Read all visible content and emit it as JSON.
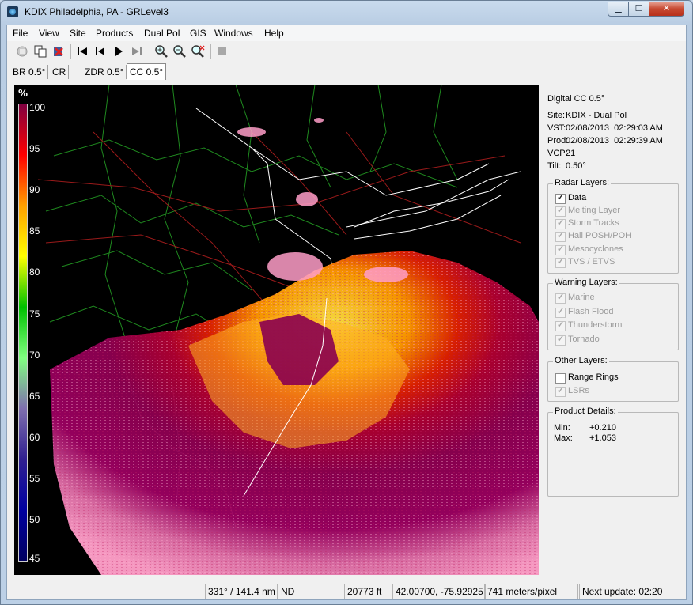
{
  "window": {
    "title": "KDIX Philadelphia, PA - GRLevel3",
    "minimize_glyph": "▁",
    "maximize_glyph": "☐",
    "close_glyph": "✕",
    "app_icon": "radar-app-icon"
  },
  "menu": [
    "File",
    "View",
    "Site",
    "Products",
    "Dual Pol",
    "GIS",
    "Windows",
    "Help"
  ],
  "toolbar": {
    "icons": [
      "refresh-disabled-icon",
      "copy-icon",
      "delete-icon",
      "first-frame-icon",
      "previous-frame-icon",
      "play-icon",
      "last-frame-icon",
      "zoom-in-icon",
      "zoom-out-icon",
      "zoom-reset-icon",
      "stop-icon"
    ]
  },
  "tabs": [
    "BR 0.5°",
    "CR",
    "ZDR 0.5°",
    "CC 0.5°"
  ],
  "active_tab": "CC 0.5°",
  "legend": {
    "unit": "%",
    "ticks": [
      "100",
      "95",
      "90",
      "85",
      "80",
      "75",
      "70",
      "65",
      "60",
      "55",
      "50",
      "45"
    ],
    "colors": [
      "#800040",
      "#ff0000",
      "#ffa000",
      "#ffff00",
      "#00c000",
      "#80ff80",
      "#7f6faf",
      "#302090",
      "#0000a0",
      "#000060"
    ]
  },
  "info": {
    "product": "Digital CC 0.5°",
    "site_label": "Site:",
    "site_value": "KDIX - Dual Pol",
    "vst_label": "VST:",
    "vst_value": "02/08/2013  02:29:03 AM",
    "prod_label": "Prod:",
    "prod_value": "02/08/2013  02:29:39 AM",
    "vcp_label": "VCP:",
    "vcp_value": "21",
    "tilt_label": "Tilt:",
    "tilt_value": "0.50°"
  },
  "radar_layers": {
    "title": "Radar Layers:",
    "items": [
      {
        "label": "Data",
        "checked": true,
        "enabled": true
      },
      {
        "label": "Melting Layer",
        "checked": true,
        "enabled": false
      },
      {
        "label": "Storm Tracks",
        "checked": true,
        "enabled": false
      },
      {
        "label": "Hail POSH/POH",
        "checked": true,
        "enabled": false
      },
      {
        "label": "Mesocyclones",
        "checked": true,
        "enabled": false
      },
      {
        "label": "TVS / ETVS",
        "checked": true,
        "enabled": false
      }
    ]
  },
  "warning_layers": {
    "title": "Warning Layers:",
    "items": [
      {
        "label": "Marine",
        "checked": true,
        "enabled": false
      },
      {
        "label": "Flash Flood",
        "checked": true,
        "enabled": false
      },
      {
        "label": "Thunderstorm",
        "checked": true,
        "enabled": false
      },
      {
        "label": "Tornado",
        "checked": true,
        "enabled": false
      }
    ]
  },
  "other_layers": {
    "title": "Other Layers:",
    "items": [
      {
        "label": "Range Rings",
        "checked": false,
        "enabled": true
      },
      {
        "label": "LSRs",
        "checked": true,
        "enabled": false
      }
    ]
  },
  "product_details": {
    "title": "Product Details:",
    "min_label": "Min:",
    "min_value": "+0.210",
    "max_label": "Max:",
    "max_value": "+1.053"
  },
  "status": {
    "azimuth_range": "331° / 141.4 nm",
    "value": "ND",
    "height": "20773 ft",
    "latlon": "42.00700, -75.92925",
    "resolution": "741 meters/pixel",
    "next_update": "Next update: 02:20"
  }
}
